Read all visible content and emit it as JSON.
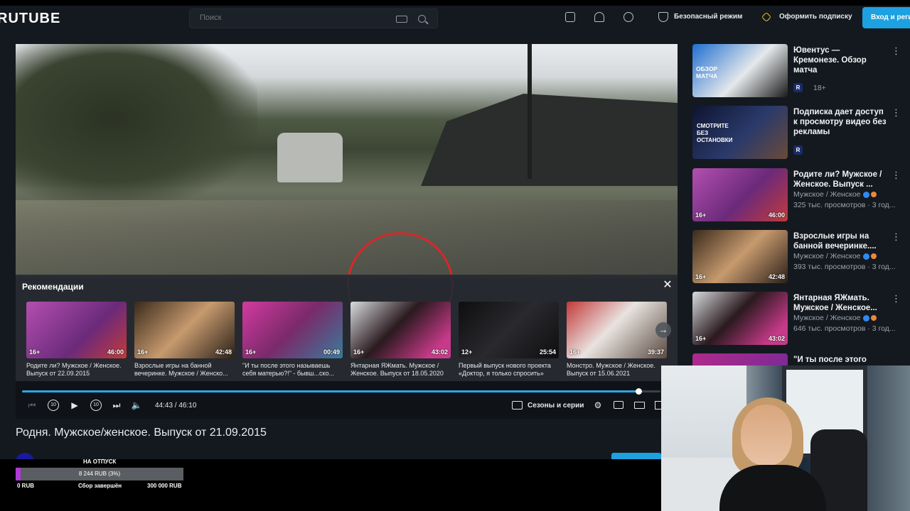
{
  "header": {
    "logo": "RUTUBE",
    "search_placeholder": "Поиск",
    "safe_mode": "Безопасный режим",
    "subscribe": "Оформить подписку",
    "login": "Вход и регистрация"
  },
  "player": {
    "recommendations_title": "Рекомендации",
    "recommendations": [
      {
        "age": "16+",
        "duration": "46:00",
        "caption": "Родите ли? Мужское / Женское. Выпуск от 22.09.2015"
      },
      {
        "age": "16+",
        "duration": "42:48",
        "caption": "Взрослые игры на банной вечеринке. Мужское / Женско..."
      },
      {
        "age": "16+",
        "duration": "00:49",
        "caption": "\"И ты после этого называешь себя матерью?!\" - бывш...ско..."
      },
      {
        "age": "16+",
        "duration": "43:02",
        "caption": "Янтарная ЯЖмать. Мужское / Женское. Выпуск от 18.05.2020"
      },
      {
        "age": "12+",
        "duration": "25:54",
        "caption": "Первый выпуск нового проекта «Доктор, я только спросить»"
      },
      {
        "age": "16+",
        "duration": "39:37",
        "caption": "Монстро. Мужское / Женское. Выпуск от 15.06.2021"
      }
    ],
    "progress_fraction": 0.966,
    "time": "44:43 / 46:10",
    "skip_back": "10",
    "skip_fwd": "10",
    "seasons": "Сезоны и серии",
    "video_title": "Родня. Мужское/женское. Выпуск от 21.09.2015"
  },
  "sidebar": [
    {
      "title": "Ювентус — Кремонезе. Обзор матча",
      "meta": "18+",
      "thumb_text": "ОБЗОР МАТЧА",
      "thumb_color": "#1f6fd0"
    },
    {
      "title": "Подписка дает доступ к просмотру видео без рекламы",
      "meta": "",
      "thumb_text": "СМОТРИТЕ БЕЗ ОСТАНОВКИ",
      "thumb_color": "#1a2340"
    },
    {
      "title": "Родите ли? Мужское / Женское. Выпуск ...",
      "channel": "Мужское / Женское",
      "meta": "325 тыс. просмотров · 3 год...",
      "age": "16+",
      "duration": "46:00",
      "thumb_color": "#9a3fa0"
    },
    {
      "title": "Взрослые игры на банной вечеринке....",
      "channel": "Мужское / Женское",
      "meta": "393 тыс. просмотров · 3 год...",
      "age": "16+",
      "duration": "42:48",
      "thumb_color": "#4a3828"
    },
    {
      "title": "Янтарная ЯЖмать. Мужское / Женское...",
      "channel": "Мужское / Женское",
      "meta": "646 тыс. просмотров · 3 год...",
      "age": "16+",
      "duration": "43:02",
      "thumb_color": "#cfd2d6"
    },
    {
      "title": "\"И ты после этого",
      "meta": "",
      "thumb_color": "#b02a8a"
    }
  ],
  "donation": {
    "title": "НА ОТПУСК",
    "amount": "8 244 RUB (3%)",
    "fill_fraction": 0.03,
    "min": "0 RUB",
    "status": "Сбор завершён",
    "max": "300 000 RUB"
  }
}
